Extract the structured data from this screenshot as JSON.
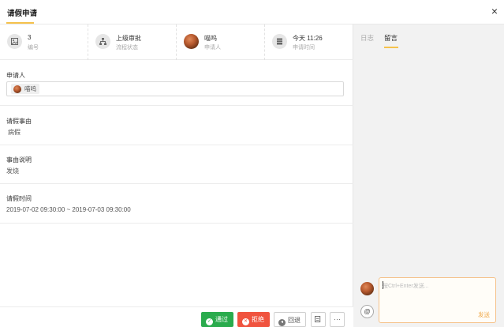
{
  "header": {
    "title": "请假申请",
    "close_icon": "×"
  },
  "stats": [
    {
      "icon": "image-icon",
      "value": "3",
      "label": "编号"
    },
    {
      "icon": "org-chart-icon",
      "value": "上级审批",
      "label": "流程状态"
    },
    {
      "icon": "avatar",
      "value": "喵呜",
      "label": "申请人"
    },
    {
      "icon": "table-icon",
      "value": "今天 11:26",
      "label": "申请时间"
    }
  ],
  "fields": {
    "applicant": {
      "label": "申请人",
      "chip": "喵呜"
    },
    "reason": {
      "label": "请假事由",
      "value": "病假"
    },
    "description": {
      "label": "事由说明",
      "value": "发烧"
    },
    "time": {
      "label": "请假时间",
      "value": "2019-07-02 09:30:00 ~ 2019-07-03 09:30:00"
    }
  },
  "actions": {
    "pass": "通过",
    "reject": "拒绝",
    "back": "回退",
    "save_icon": "save-icon",
    "more": "···"
  },
  "side": {
    "tabs": [
      "日志",
      "留言"
    ],
    "active_tab": "留言",
    "input_placeholder": "按Ctrl+Enter发送...",
    "send": "发送",
    "at": "@"
  },
  "colors": {
    "accent": "#f5c24c",
    "pass": "#2aab4d",
    "reject": "#f0533e"
  }
}
